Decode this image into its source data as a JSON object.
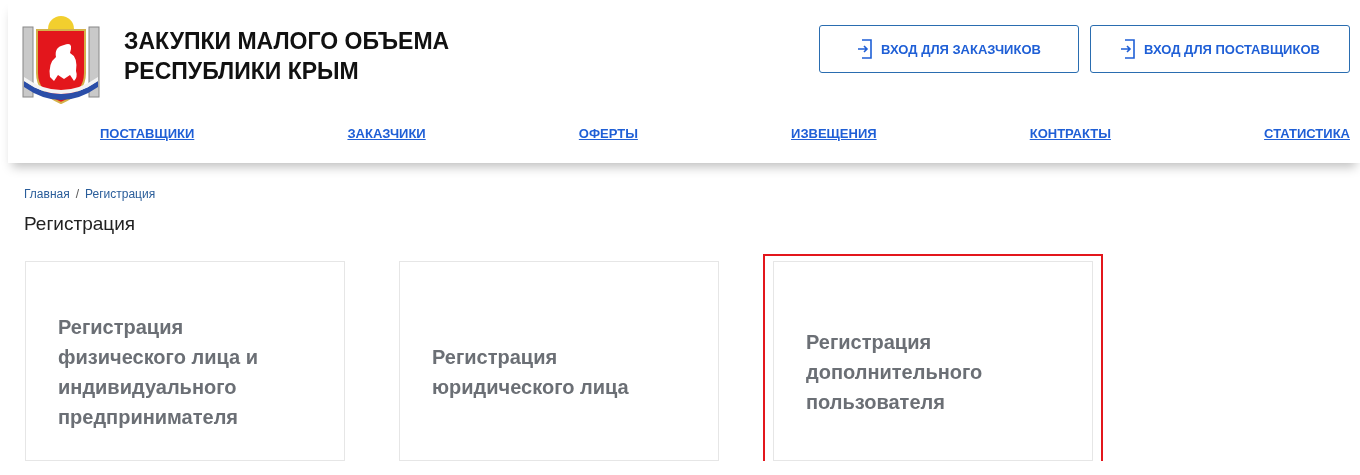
{
  "header": {
    "title_lines": [
      "ЗАКУПКИ МАЛОГО ОБЪЕМА",
      "РЕСПУБЛИКИ КРЫМ"
    ],
    "buttons": [
      "ВХОД ДЛЯ ЗАКАЗЧИКОВ",
      "ВХОД ДЛЯ ПОСТАВЩИКОВ"
    ]
  },
  "nav": [
    "ПОСТАВЩИКИ",
    "ЗАКАЗЧИКИ",
    "ОФЕРТЫ",
    "ИЗВЕЩЕНИЯ",
    "КОНТРАКТЫ",
    "СТАТИСТИКА"
  ],
  "breadcrumb": {
    "items": [
      "Главная",
      "Регистрация"
    ],
    "separator": "/"
  },
  "page_title": "Регистрация",
  "cards": [
    {
      "lines": [
        "Регистрация",
        "физического лица и",
        "индивидуального",
        "предпринимателя"
      ],
      "highlighted": false
    },
    {
      "lines": [
        "Регистрация",
        "юридического лица"
      ],
      "highlighted": false
    },
    {
      "lines": [
        "Регистрация",
        "дополнительного",
        "пользователя"
      ],
      "highlighted": true
    }
  ]
}
